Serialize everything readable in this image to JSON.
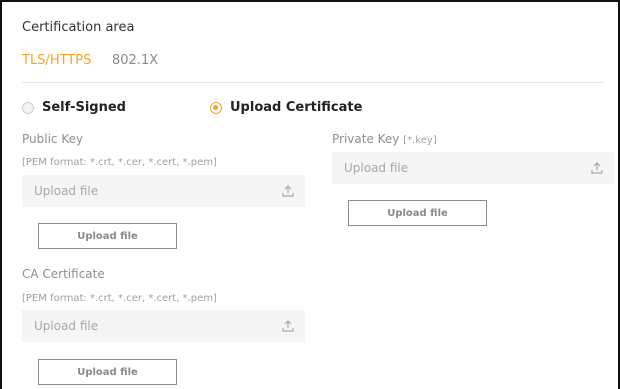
{
  "section": {
    "title": "Certification area"
  },
  "tabs": [
    {
      "label": "TLS/HTTPS",
      "active": true
    },
    {
      "label": "802.1X",
      "active": false
    }
  ],
  "mode": {
    "options": [
      {
        "label": "Self-Signed",
        "selected": false
      },
      {
        "label": "Upload Certificate",
        "selected": true
      }
    ]
  },
  "public_key": {
    "label": "Public Key",
    "hint": "[PEM format: *.crt, *.cer, *.cert, *.pem]",
    "input_placeholder": "Upload file",
    "button_label": "Upload file"
  },
  "private_key": {
    "label": "Private Key",
    "label_suffix": "[*.key]",
    "input_placeholder": "Upload file",
    "button_label": "Upload file"
  },
  "ca_certificate": {
    "label": "CA Certificate",
    "hint": "[PEM format: *.crt, *.cer, *.cert, *.pem]",
    "input_placeholder": "Upload file",
    "button_label": "Upload file"
  },
  "colors": {
    "accent": "#f5a623",
    "input_bg": "#f5f5f5",
    "muted_text": "#8f8f8f"
  },
  "icons": {
    "upload": "upload-icon"
  }
}
